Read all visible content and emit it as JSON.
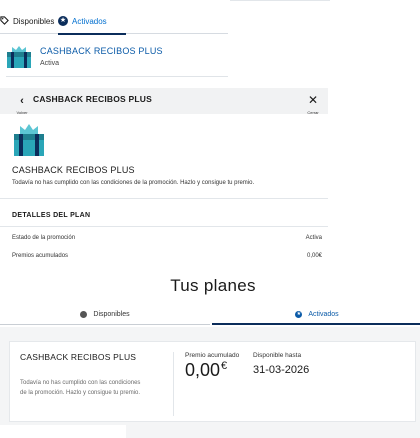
{
  "panel_list": {
    "tabs": [
      {
        "label": "Disponibles",
        "icon": "tag-icon"
      },
      {
        "label": "Activados",
        "icon": "star-icon",
        "active": true
      }
    ],
    "plan": {
      "title": "CASHBACK RECIBOS PLUS",
      "status": "Activa",
      "icon": "gift-icon"
    }
  },
  "panel_detail": {
    "header": {
      "title": "CASHBACK RECIBOS PLUS",
      "back_label": "Volver",
      "close_label": "Cerrar"
    },
    "name": "CASHBACK RECIBOS PLUS",
    "description": "Todavía no has cumplido con las condiciones de la promoción. Hazlo y consigue tu premio.",
    "details_heading": "DETALLES DEL PLAN",
    "rows": [
      {
        "key": "Estado de la promoción",
        "value": "Activa"
      },
      {
        "key": "Premios acumulados",
        "value": "0,00€"
      }
    ]
  },
  "panel_desktop": {
    "heading": "Tus planes",
    "tabs": [
      {
        "label": "Disponibles"
      },
      {
        "label": "Activados",
        "active": true
      }
    ],
    "card": {
      "title": "CASHBACK RECIBOS PLUS",
      "description": "Todavía no has cumplido con las condiciones de la promoción. Hazlo y consigue tu premio.",
      "premio_label": "Premio acumulado",
      "premio_value": "0,00",
      "premio_currency": "€",
      "disponible_label": "Disponible hasta",
      "disponible_value": "31-03-2026"
    }
  },
  "colors": {
    "accent": "#0b5ba8",
    "navy": "#0b2d5b",
    "gift_teal": "#2aa6b8"
  }
}
